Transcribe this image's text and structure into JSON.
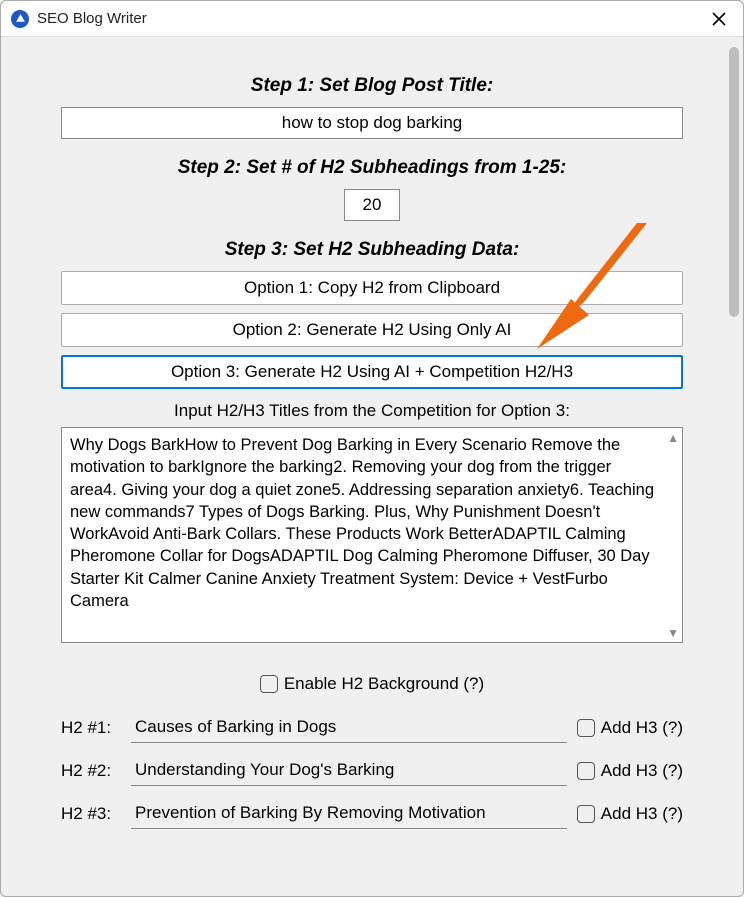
{
  "window": {
    "title": "SEO Blog Writer"
  },
  "steps": {
    "s1_label": "Step 1: Set Blog Post Title:",
    "s1_value": "how to stop dog barking",
    "s2_label": "Step 2: Set # of H2 Subheadings from 1-25:",
    "s2_value": "20",
    "s3_label": "Step 3: Set H2 Subheading Data:",
    "option1": "Option 1: Copy H2 from Clipboard",
    "option2": "Option 2: Generate H2 Using Only AI",
    "option3": "Option 3: Generate H2 Using AI + Competition H2/H3",
    "input_comp_label": "Input H2/H3 Titles from the Competition for Option 3:",
    "competition_text": "Why Dogs BarkHow to Prevent Dog Barking in Every Scenario Remove the motivation to barkIgnore the barking2. Removing your dog from the trigger area4. Giving your dog a quiet zone5. Addressing separation anxiety6. Teaching new commands7 Types of Dogs Barking. Plus, Why Punishment Doesn't WorkAvoid Anti-Bark Collars. These Products Work BetterADAPTIL Calming Pheromone Collar for DogsADAPTIL Dog Calming Pheromone Diffuser, 30 Day Starter Kit Calmer Canine Anxiety Treatment System: Device + VestFurbo Camera"
  },
  "enable_bg": {
    "label": "Enable H2 Background (?)"
  },
  "h2_rows": [
    {
      "label": "H2 #1:",
      "value": "Causes of Barking in Dogs",
      "add": "Add H3 (?)"
    },
    {
      "label": "H2 #2:",
      "value": "Understanding Your Dog's Barking",
      "add": "Add H3 (?)"
    },
    {
      "label": "H2 #3:",
      "value": "Prevention of Barking By Removing Motivation",
      "add": "Add H3 (?)"
    }
  ]
}
